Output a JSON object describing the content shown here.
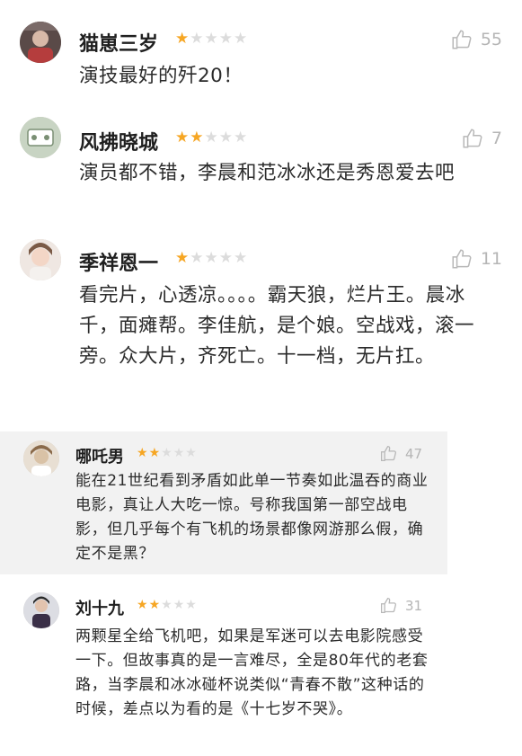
{
  "reviews": [
    {
      "user": "猫崽三岁",
      "stars": 1,
      "likes": "55",
      "text": "演技最好的歼20！"
    },
    {
      "user": "风拂晓城",
      "stars": 2,
      "likes": "7",
      "text": "演员都不错，李晨和范冰冰还是秀恩爱去吧"
    },
    {
      "user": "季祥恩一",
      "stars": 1,
      "likes": "11",
      "text": "看完片，心透凉。。。。霸天狼，烂片王。晨冰千，面瘫帮。李佳航，是个娘。空战戏，滚一旁。众大片，齐死亡。十一档，无片扛。"
    },
    {
      "user": "哪吒男",
      "stars": 2,
      "likes": "47",
      "text": "能在21世纪看到矛盾如此单一节奏如此温吞的商业电影，真让人大吃一惊。号称我国第一部空战电影，但几乎每个有飞机的场景都像网游那么假，确定不是黑？"
    },
    {
      "user": "刘十九",
      "stars": 2,
      "likes": "31",
      "text": "两颗星全给飞机吧，如果是军迷可以去电影院感受一下。但故事真的是一言难尽，全是80年代的老套路，当李晨和冰冰碰杯说类似“青春不散”这种话的时候，差点以为看的是《十七岁不哭》。"
    }
  ],
  "icons": {
    "like": "thumbs-up-icon",
    "star": "star-icon"
  },
  "colors": {
    "star_on": "#f6a623",
    "star_off": "#dcdcdc",
    "highlight_bg": "#f2f2f2"
  }
}
